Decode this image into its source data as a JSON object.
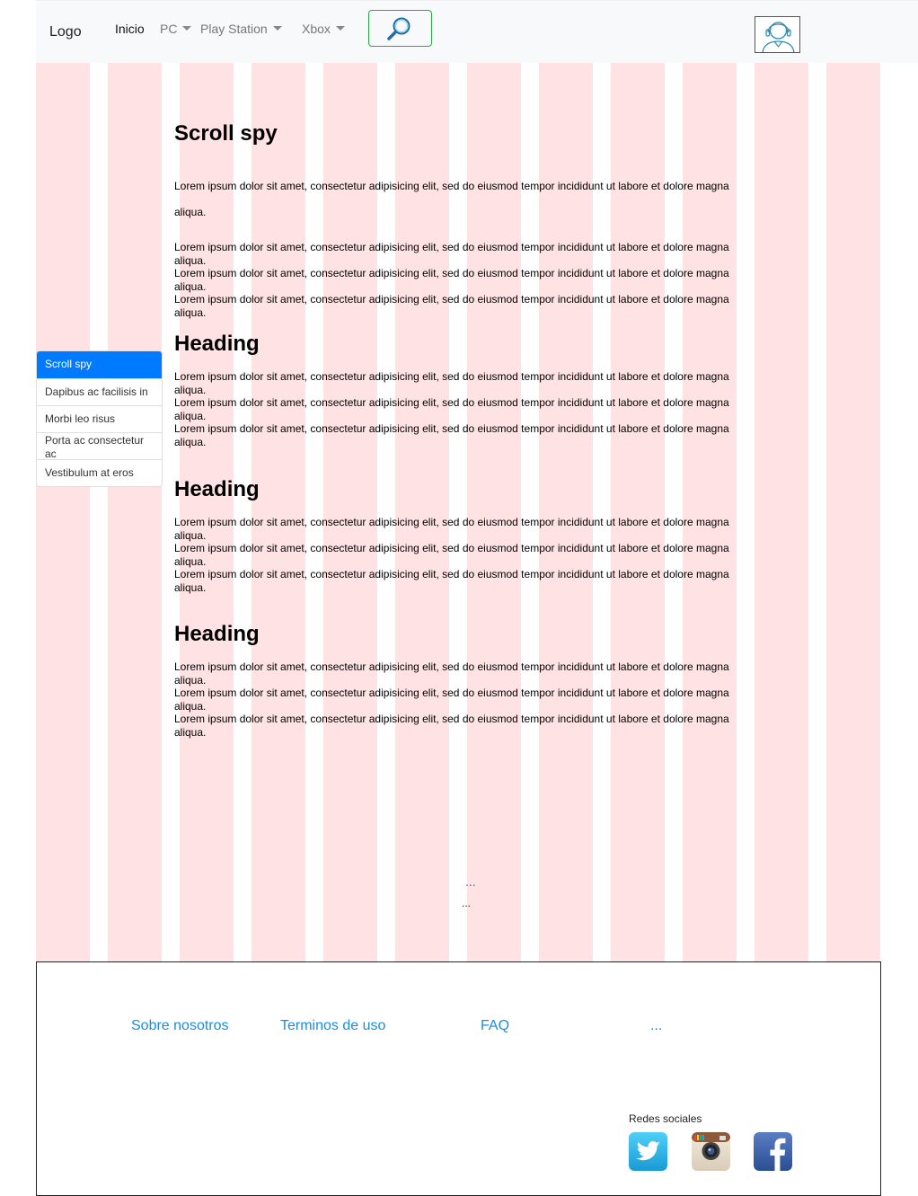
{
  "navbar": {
    "logo": "Logo",
    "items": [
      {
        "label": "Inicio",
        "dropdown": false
      },
      {
        "label": "PC",
        "dropdown": true
      },
      {
        "label": "Play Station",
        "dropdown": true
      },
      {
        "label": "Xbox",
        "dropdown": true
      }
    ],
    "search_icon": "search-icon",
    "avatar_icon": "user-avatar-icon"
  },
  "sidebar": {
    "items": [
      {
        "label": "Scroll spy",
        "active": true
      },
      {
        "label": "Dapibus ac facilisis in",
        "active": false
      },
      {
        "label": "Morbi leo risus",
        "active": false
      },
      {
        "label": "Porta ac consectetur ac",
        "active": false
      },
      {
        "label": "Vestibulum at eros",
        "active": false
      }
    ]
  },
  "content": {
    "lorem": "Lorem ipsum dolor sit amet, consectetur adipisicing elit, sed do eiusmod tempor incididunt ut labore et dolore magna aliqua.",
    "sections": [
      {
        "heading": "Scroll spy"
      },
      {
        "heading": "Heading"
      },
      {
        "heading": "Heading"
      },
      {
        "heading": "Heading"
      }
    ],
    "more_link": "...",
    "more_text": "..."
  },
  "footer": {
    "links": [
      "Sobre nosotros",
      "Terminos de uso",
      "FAQ",
      "..."
    ],
    "social_title": "Redes sociales",
    "social_icons": [
      "twitter-icon",
      "instagram-icon",
      "facebook-icon"
    ]
  },
  "colors": {
    "grid_column": "#ffe3e4",
    "primary": "#007bff",
    "search_border": "#28a745",
    "footer_link": "#1a8de0"
  }
}
